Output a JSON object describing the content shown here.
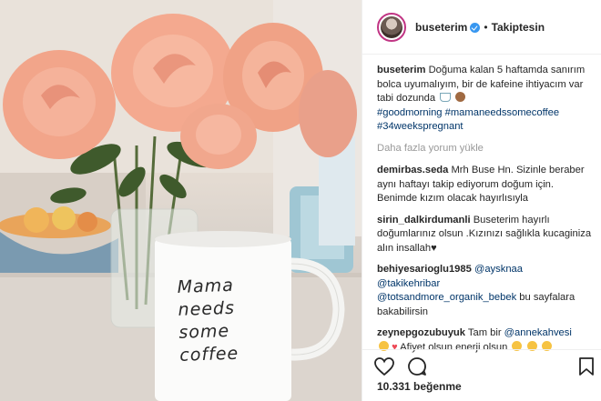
{
  "post": {
    "username": "buseterim",
    "separator": "•",
    "follow_label": "Takiptesin"
  },
  "caption": {
    "username": "buseterim",
    "text": "Doğuma kalan 5 haftamda sanırım bolca uyumalıyım, bir de kafeine ihtiyacım var tabi dozunda",
    "hashtags": [
      "#goodmorning",
      "#mamaneedssomecoffee",
      "#34weekspregnant"
    ]
  },
  "load_more": "Daha fazla yorum yükle",
  "comments": [
    {
      "username": "demirbas.seda",
      "text": "Mrh Buse Hn. Sizinle beraber aynı haftayı takip ediyorum doğum için. Benimde kızım olacak hayırlısıyla"
    },
    {
      "username": "sirin_dalkirdumanli",
      "text": "Buseterim hayırlı doğumlarınız olsun .Kızınızı sağlıkla kucaginiza alın insallah"
    },
    {
      "username": "behiyesarioglu1985",
      "mentions": [
        "@aysknaa",
        "@takikehribar",
        "@totsandmore_organik_bebek"
      ],
      "text": "bu sayfalara bakabilirsin"
    },
    {
      "username": "zeynepgozubuyuk",
      "text_before": "Tam bir",
      "mention": "@annekahvesi",
      "text_after": "Afiyet olsun enerji olsun"
    }
  ],
  "likes": "10.331 beğenme",
  "mug": {
    "line1": "Mama",
    "line2": "needs",
    "line3": "some",
    "line4": "coffee"
  },
  "colors": {
    "verified": "#3897f0",
    "hashtag": "#003569",
    "muted": "#999999",
    "heart": "#ed4956"
  },
  "icons": [
    "heart-icon",
    "comment-icon",
    "bookmark-icon",
    "verified-badge-icon"
  ]
}
